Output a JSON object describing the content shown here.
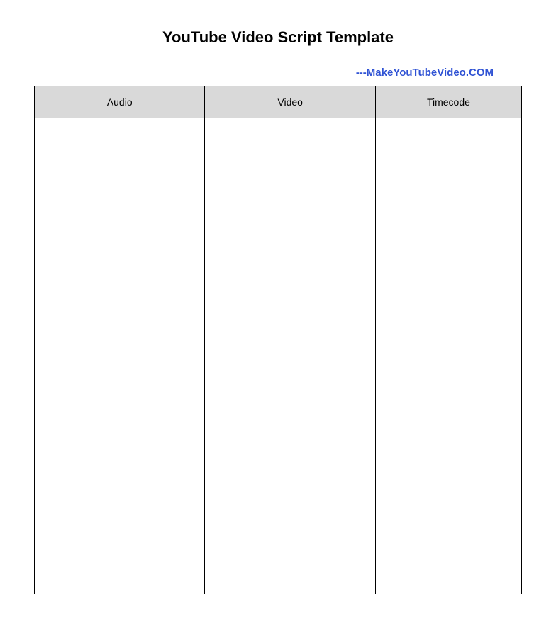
{
  "title": "YouTube Video Script Template",
  "attribution": "---MakeYouTubeVideo.COM",
  "columns": {
    "audio": "Audio",
    "video": "Video",
    "timecode": "Timecode"
  },
  "rows": [
    {
      "audio": "",
      "video": "",
      "timecode": ""
    },
    {
      "audio": "",
      "video": "",
      "timecode": ""
    },
    {
      "audio": "",
      "video": "",
      "timecode": ""
    },
    {
      "audio": "",
      "video": "",
      "timecode": ""
    },
    {
      "audio": "",
      "video": "",
      "timecode": ""
    },
    {
      "audio": "",
      "video": "",
      "timecode": ""
    },
    {
      "audio": "",
      "video": "",
      "timecode": ""
    }
  ]
}
